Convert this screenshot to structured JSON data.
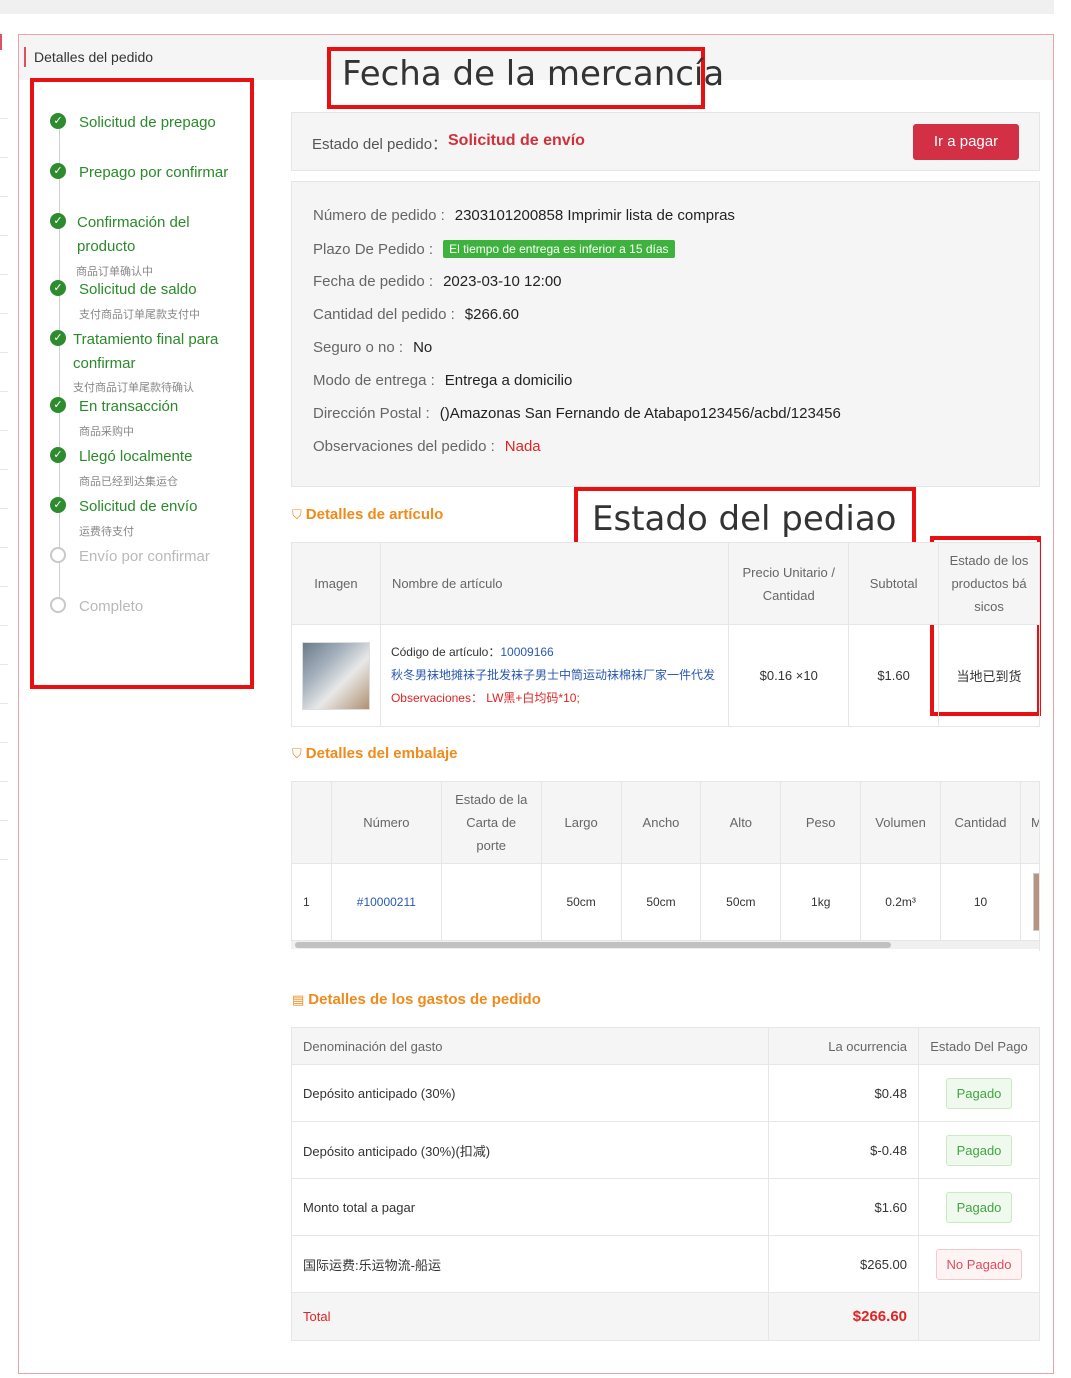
{
  "page": {
    "title": "Detalles del pedido"
  },
  "annotations": {
    "goods_date": "Fecha de la mercancía",
    "order_status": "Estado del pediao"
  },
  "timeline": [
    {
      "label": "Solicitud de prepago",
      "done": true
    },
    {
      "label": "Prepago por confirmar",
      "done": true
    },
    {
      "label": "Confirmación del producto",
      "sub": "商品订单确认中",
      "done": true
    },
    {
      "label": "Solicitud de saldo",
      "sub": "支付商品订单尾款支付中",
      "done": true
    },
    {
      "label": "Tratamiento final para confirmar",
      "sub": "支付商品订单尾款待确认",
      "done": true
    },
    {
      "label": "En transacción",
      "sub": "商品采购中",
      "done": true
    },
    {
      "label": "Llegó localmente",
      "sub": "商品已经到达集运仓",
      "done": true
    },
    {
      "label": "Solicitud de envío",
      "sub": "运费待支付",
      "done": true
    },
    {
      "label": "Envío por confirmar",
      "done": false
    },
    {
      "label": "Completo",
      "done": false
    }
  ],
  "status": {
    "label": "Estado del pedido：",
    "value": "Solicitud de envío",
    "pay_button": "Ir a pagar"
  },
  "order": {
    "number_label": "Número de pedido :",
    "number": "2303101200858",
    "print_link": "Imprimir lista de compras",
    "term_label": "Plazo De Pedido :",
    "term_tag": "El tiempo de entrega es inferior a 15 días",
    "date_label": "Fecha de pedido :",
    "date": "2023-03-10 12:00",
    "amount_label": "Cantidad del pedido :",
    "amount": "$266.60",
    "insurance_label": "Seguro o no :",
    "insurance": "No",
    "delivery_label": "Modo de entrega :",
    "delivery": "Entrega a domicilio",
    "address_label": "Dirección Postal :",
    "address": "()Amazonas San Fernando de Atabapo123456/acbd/123456",
    "notes_label": "Observaciones del pedido :",
    "notes": "Nada"
  },
  "items_section": {
    "title": "Detalles de artículo",
    "headers": [
      "Imagen",
      "Nombre de artículo",
      "Precio Unitario / Cantidad",
      "Subtotal",
      "Estado de los productos bá sicos"
    ],
    "rows": [
      {
        "code_label": "Código de artículo：",
        "code": "10009166",
        "name": "秋冬男袜地摊袜子批发袜子男士中筒运动袜棉袜厂家一件代发",
        "notes": "Observaciones：  LW黑+白均码*10;",
        "price_qty": "$0.16 ×10",
        "subtotal": "$1.60",
        "status": "当地已到货"
      }
    ]
  },
  "packing_section": {
    "title": "Detalles del embalaje",
    "headers": [
      "",
      "Número",
      "Estado de la Carta de porte",
      "Largo",
      "Ancho",
      "Alto",
      "Peso",
      "Volumen",
      "Cantidad",
      "M"
    ],
    "rows": [
      {
        "idx": "1",
        "number": "#10000211",
        "waybill": "",
        "length": "50cm",
        "width": "50cm",
        "height": "50cm",
        "weight": "1kg",
        "volume": "0.2m³",
        "qty": "10"
      }
    ]
  },
  "fees_section": {
    "title": "Detalles de los gastos de pedido",
    "headers": [
      "Denominación del gasto",
      "La ocurrencia",
      "Estado Del Pago"
    ],
    "rows": [
      {
        "name": "Depósito anticipado (30%)",
        "amount": "$0.48",
        "status": "Pagado",
        "paid": true
      },
      {
        "name": "Depósito anticipado (30%)(扣减)",
        "amount": "$-0.48",
        "status": "Pagado",
        "paid": true
      },
      {
        "name": "Monto total a pagar",
        "amount": "$1.60",
        "status": "Pagado",
        "paid": true
      },
      {
        "name": "国际运费:乐运物流-船运",
        "amount": "$265.00",
        "status": "No Pagado",
        "paid": false
      }
    ],
    "total_label": "Total",
    "total": "$266.60"
  },
  "colors": {
    "accent": "#d32f45",
    "success": "#2e8b2e",
    "section": "#f08a1a",
    "annotation": "#e81010"
  }
}
